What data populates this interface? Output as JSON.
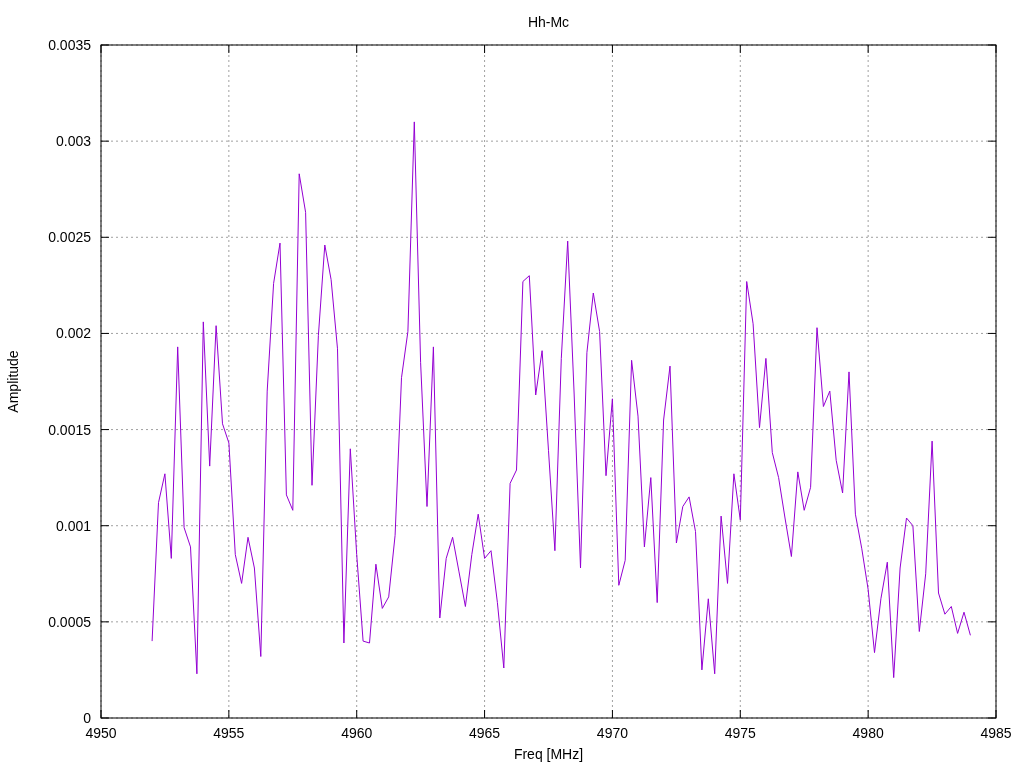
{
  "chart_data": {
    "type": "line",
    "grid": true,
    "xlabel": "Freq [MHz]",
    "ylabel": "Amplitude",
    "x": [
      4952,
      4952.25,
      4952.5,
      4952.75,
      4953,
      4953.25,
      4953.5,
      4953.75,
      4954,
      4954.25,
      4954.5,
      4954.75,
      4955,
      4955.25,
      4955.5,
      4955.75,
      4956,
      4956.25,
      4956.5,
      4956.75,
      4957,
      4957.25,
      4957.5,
      4957.75,
      4958,
      4958.25,
      4958.5,
      4958.75,
      4959,
      4959.25,
      4959.5,
      4959.75,
      4960,
      4960.25,
      4960.5,
      4960.75,
      4961,
      4961.25,
      4961.5,
      4961.75,
      4962,
      4962.25,
      4962.5,
      4962.75,
      4963,
      4963.25,
      4963.5,
      4963.75,
      4964,
      4964.25,
      4964.5,
      4964.75,
      4965,
      4965.25,
      4965.5,
      4965.75,
      4966,
      4966.25,
      4966.5,
      4966.75,
      4967,
      4967.25,
      4967.5,
      4967.75,
      4968,
      4968.25,
      4968.5,
      4968.75,
      4969,
      4969.25,
      4969.5,
      4969.75,
      4970,
      4970.25,
      4970.5,
      4970.75,
      4971,
      4971.25,
      4971.5,
      4971.75,
      4972,
      4972.25,
      4972.5,
      4972.75,
      4973,
      4973.25,
      4973.5,
      4973.75,
      4974,
      4974.25,
      4974.5,
      4974.75,
      4975,
      4975.25,
      4975.5,
      4975.75,
      4976,
      4976.25,
      4976.5,
      4976.75,
      4977,
      4977.25,
      4977.5,
      4977.75,
      4978,
      4978.25,
      4978.5,
      4978.75,
      4979,
      4979.25,
      4979.5,
      4979.75,
      4980,
      4980.25,
      4980.5,
      4980.75,
      4981,
      4981.25,
      4981.5,
      4981.75,
      4982,
      4982.25,
      4982.5,
      4982.75,
      4983,
      4983.25,
      4983.5,
      4983.75,
      4984
    ],
    "series": [
      {
        "name": "Hh-Mc",
        "color": "#9400d3",
        "values": [
          0.0004,
          0.00112,
          0.00127,
          0.00083,
          0.00193,
          0.00099,
          0.00089,
          0.00023,
          0.00206,
          0.00131,
          0.00204,
          0.00153,
          0.00143,
          0.00085,
          0.0007,
          0.00094,
          0.00078,
          0.00032,
          0.0017,
          0.00226,
          0.00247,
          0.00116,
          0.00108,
          0.00283,
          0.00263,
          0.00121,
          0.00199,
          0.00246,
          0.00228,
          0.00192,
          0.00039,
          0.0014,
          0.00085,
          0.0004,
          0.00039,
          0.0008,
          0.00057,
          0.00063,
          0.00095,
          0.00177,
          0.00201,
          0.0031,
          0.00185,
          0.0011,
          0.00193,
          0.00052,
          0.00083,
          0.00094,
          0.00076,
          0.00058,
          0.00085,
          0.00106,
          0.00083,
          0.00087,
          0.0006,
          0.00026,
          0.00122,
          0.00129,
          0.00227,
          0.0023,
          0.00168,
          0.00191,
          0.00139,
          0.00087,
          0.00187,
          0.00248,
          0.00169,
          0.00078,
          0.0019,
          0.00221,
          0.00201,
          0.00126,
          0.00166,
          0.00069,
          0.00082,
          0.00186,
          0.00157,
          0.00089,
          0.00125,
          0.0006,
          0.00155,
          0.00183,
          0.00091,
          0.0011,
          0.00115,
          0.00097,
          0.00025,
          0.00062,
          0.00023,
          0.00105,
          0.0007,
          0.00127,
          0.00103,
          0.00227,
          0.00205,
          0.00151,
          0.00187,
          0.00138,
          0.00125,
          0.00104,
          0.00084,
          0.00128,
          0.00108,
          0.0012,
          0.00203,
          0.00162,
          0.0017,
          0.00134,
          0.00117,
          0.0018,
          0.00106,
          0.00088,
          0.00067,
          0.00034,
          0.00062,
          0.00081,
          0.00021,
          0.00078,
          0.00104,
          0.001,
          0.00045,
          0.00075,
          0.00144,
          0.00065,
          0.00054,
          0.00058,
          0.00044,
          0.00055,
          0.00043
        ]
      }
    ],
    "xlim": [
      4950,
      4985
    ],
    "ylim": [
      0,
      0.0035
    ],
    "xticks": [
      4950,
      4955,
      4960,
      4965,
      4970,
      4975,
      4980,
      4985
    ],
    "yticks": [
      0,
      0.0005,
      0.001,
      0.0015,
      0.002,
      0.0025,
      0.003,
      0.0035
    ]
  }
}
